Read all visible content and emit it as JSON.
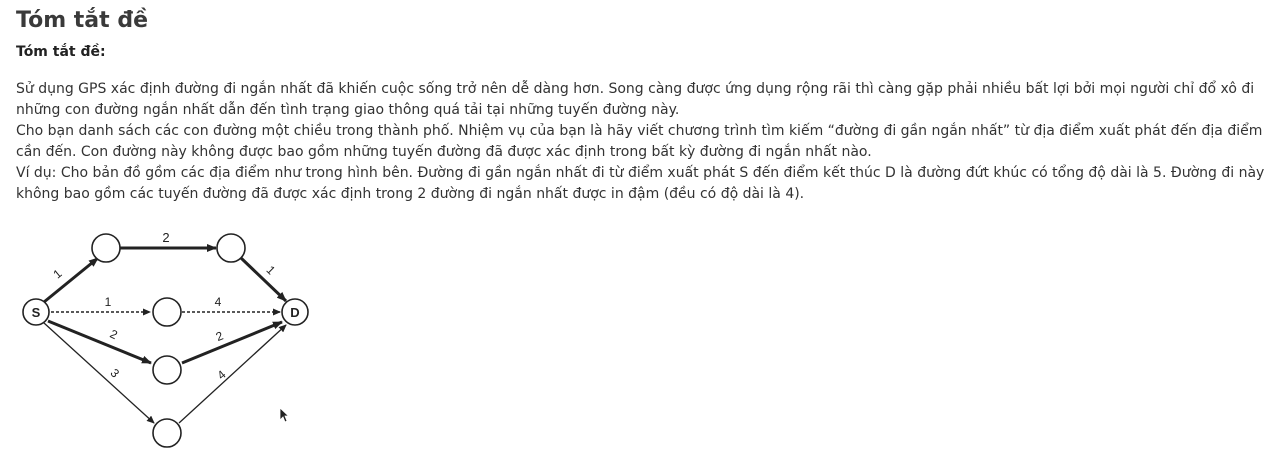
{
  "page": {
    "title": "Tóm tắt đề",
    "subheading": "Tóm tắt đề:"
  },
  "paragraphs": [
    "Sử dụng GPS xác định đường đi ngắn nhất đã khiến cuộc sống trở nên dễ dàng hơn. Song càng được ứng dụng rộng rãi thì càng gặp phải nhiều bất lợi bởi mọi người chỉ đổ xô đi những con đường ngắn nhất dẫn đến tình trạng giao thông quá tải tại những tuyến đường này.",
    "Cho bạn danh sách các con đường một chiều trong thành phố. Nhiệm vụ của bạn là hãy viết chương trình tìm kiếm “đường đi gần ngắn nhất” từ địa điểm xuất phát đến địa điểm cần đến. Con đường này không được bao gồm những tuyến đường đã được xác định trong bất kỳ đường đi ngắn nhất nào.",
    "Ví dụ: Cho bản đồ gồm các địa điểm như trong hình bên. Đường đi gần ngắn nhất đi từ điểm xuất phát S đến điểm kết thúc D là đường đứt khúc có tổng độ dài là 5. Đường đi này không bao gồm các tuyến đường đã được xác định trong 2 đường đi ngắn nhất được in đậm (đều có độ dài là 4)."
  ],
  "diagram": {
    "start_label": "S",
    "end_label": "D",
    "edge_weights": {
      "s_top": "1",
      "top_top": "2",
      "top_d": "1",
      "s_mid_dashed": "1",
      "mid_d_dashed": "4",
      "s_low": "2",
      "low_d": "2",
      "s_bottom": "3",
      "bottom_d": "4"
    }
  }
}
